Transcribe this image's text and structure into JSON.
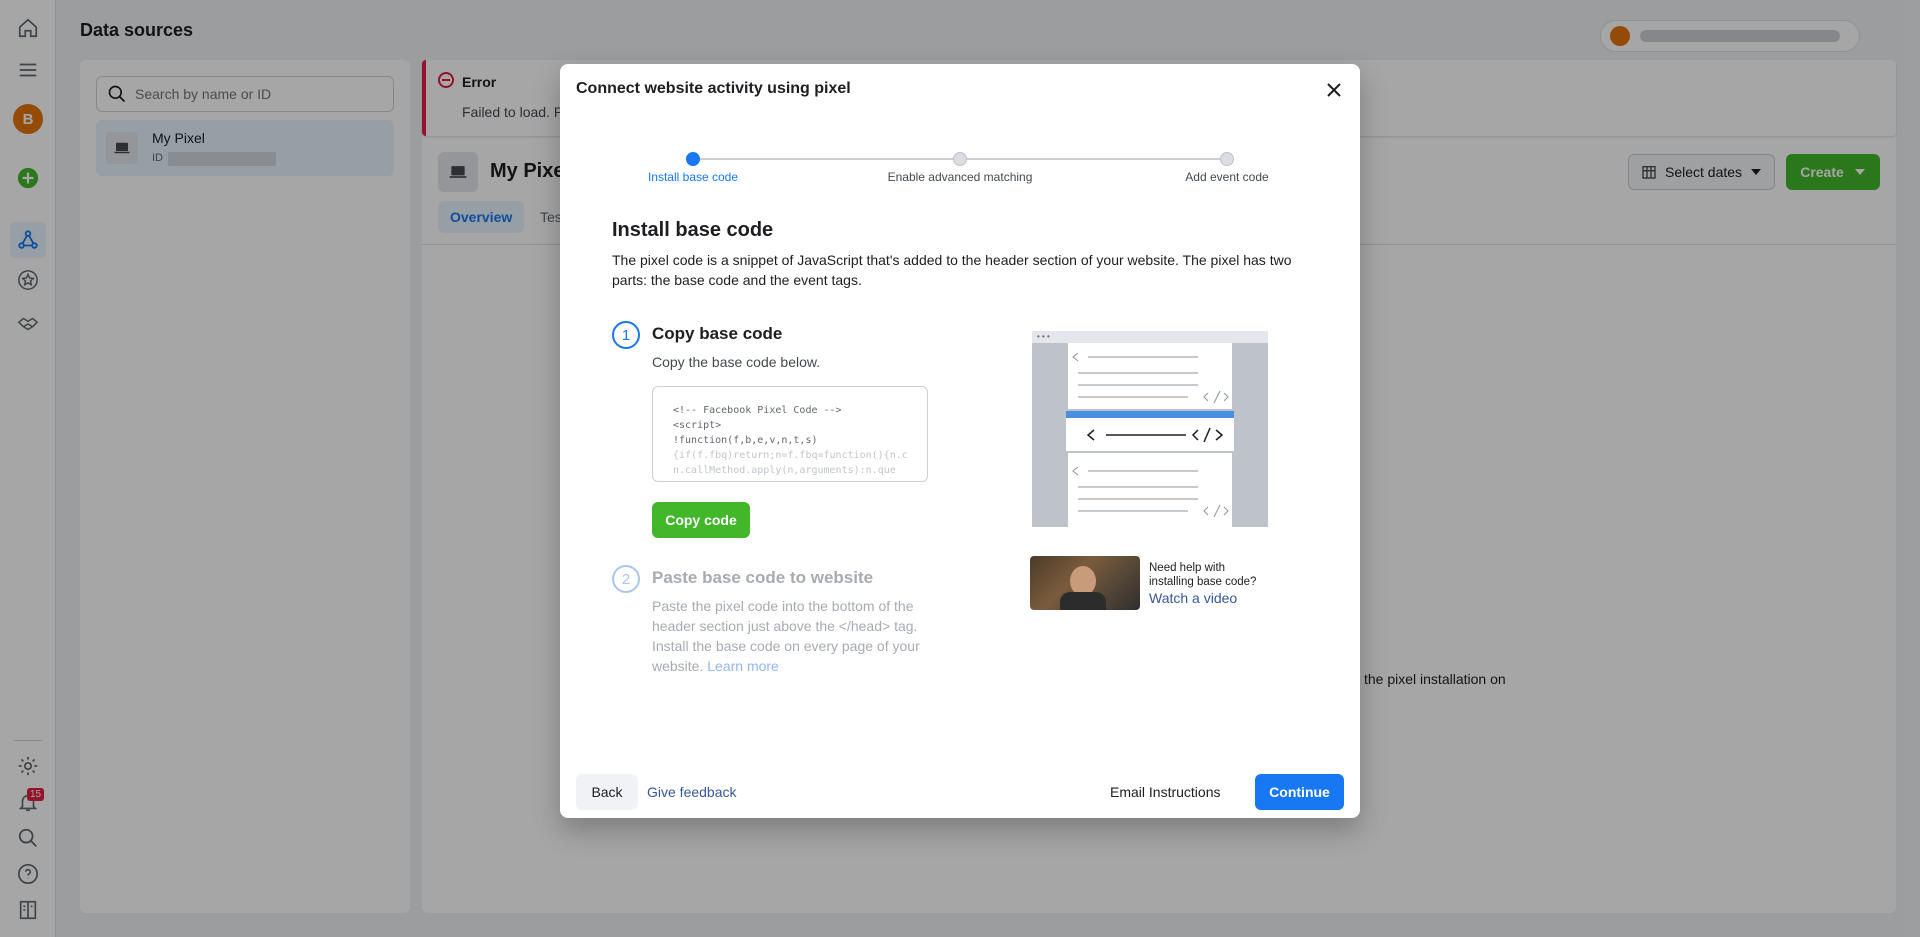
{
  "page": {
    "title": "Data sources"
  },
  "left_rail": {
    "avatar_letter": "B",
    "notification_count": "15",
    "icons": [
      "home-icon",
      "menu-icon",
      "plus-circle-icon",
      "data-sources-icon",
      "star-icon",
      "partner-icon",
      "gear-icon",
      "bell-icon",
      "search-icon",
      "help-icon",
      "report-icon"
    ]
  },
  "left_panel": {
    "search_placeholder": "Search by name or ID",
    "items": [
      {
        "name": "My Pixel",
        "id_label": "ID"
      }
    ]
  },
  "main": {
    "error_title": "Error",
    "error_message": "Failed to load. P",
    "pixel_name": "My Pixel",
    "tabs": [
      "Overview",
      "Tes"
    ],
    "select_dates": "Select dates",
    "create": "Create",
    "background_text": "the pixel installation on"
  },
  "modal": {
    "title": "Connect website activity using pixel",
    "steps": [
      {
        "label": "Install base code",
        "active": true
      },
      {
        "label": "Enable advanced matching",
        "active": false
      },
      {
        "label": "Add event code",
        "active": false
      }
    ],
    "heading": "Install base code",
    "description": "The pixel code is a snippet of JavaScript that's added to the header section of your website. The pixel has two parts: the base code and the event tags.",
    "step1": {
      "number": "1",
      "title": "Copy base code",
      "subtitle": "Copy the base code below.",
      "code_lines": [
        "<!-- Facebook Pixel Code -->",
        "<script>",
        "!function(f,b,e,v,n,t,s)",
        "{if(f.fbq)return;n=f.fbq=function(){n.c",
        "n.callMethod.apply(n,arguments):n.que"
      ],
      "copy_button": "Copy code"
    },
    "step2": {
      "number": "2",
      "title": "Paste base code to website",
      "text": "Paste the pixel code into the bottom of the header section just above the </head> tag. Install the base code on every page of your website.",
      "learn_more": "Learn more"
    },
    "video": {
      "help_text": "Need help with installing base code?",
      "link": "Watch a video"
    },
    "footer": {
      "back": "Back",
      "feedback": "Give feedback",
      "email": "Email Instructions",
      "continue": "Continue"
    }
  },
  "colors": {
    "primary": "#1877f2",
    "green": "#42b72a",
    "error": "#e41e3f"
  }
}
